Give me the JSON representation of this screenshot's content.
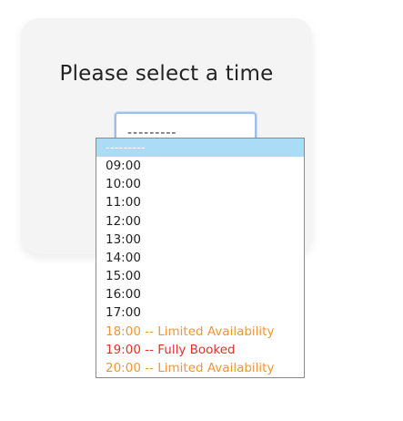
{
  "form": {
    "title": "Please select a time",
    "selected_value": "---------"
  },
  "dropdown": {
    "options": [
      {
        "label": "---------",
        "color": "#ffffff",
        "highlighted": true
      },
      {
        "label": "09:00",
        "color": "#222222",
        "highlighted": false
      },
      {
        "label": "10:00",
        "color": "#222222",
        "highlighted": false
      },
      {
        "label": "11:00",
        "color": "#222222",
        "highlighted": false
      },
      {
        "label": "12:00",
        "color": "#222222",
        "highlighted": false
      },
      {
        "label": "13:00",
        "color": "#222222",
        "highlighted": false
      },
      {
        "label": "14:00",
        "color": "#222222",
        "highlighted": false
      },
      {
        "label": "15:00",
        "color": "#222222",
        "highlighted": false
      },
      {
        "label": "16:00",
        "color": "#222222",
        "highlighted": false
      },
      {
        "label": "17:00",
        "color": "#222222",
        "highlighted": false
      },
      {
        "label": "18:00 -- Limited Availability",
        "color": "#f0963a",
        "highlighted": false
      },
      {
        "label": "19:00 -- Fully Booked",
        "color": "#e8302a",
        "highlighted": false
      },
      {
        "label": "20:00 -- Limited Availability",
        "color": "#f0963a",
        "highlighted": false
      }
    ]
  },
  "colors": {
    "highlight_background": "#aadcf5",
    "limited_availability": "#f0963a",
    "fully_booked": "#e8302a"
  }
}
